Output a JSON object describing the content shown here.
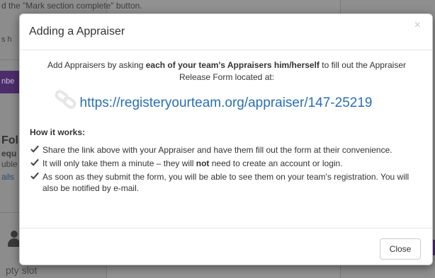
{
  "background": {
    "top_text": "d the \"Mark section complete\" button.",
    "left_fragments": [
      "s h",
      "nbe",
      "Fol",
      "equ",
      "uble",
      "ails"
    ],
    "bottom_text": "pty slot"
  },
  "modal": {
    "title": "Adding a Appraiser",
    "close_symbol": "×",
    "intro_before": "Add Appraisers by asking ",
    "intro_bold_1": "each of your team's Appraisers him/herself",
    "intro_after": " to fill out the Appraiser Release Form located at:",
    "link_url": "https://registeryourteam.org/appraiser/147-25219",
    "how_heading": "How it works:",
    "steps": [
      {
        "text": "Share the link above with your Appraiser and have them fill out the form at their convenience."
      },
      {
        "before": "It will only take them a minute – they will ",
        "bold": "not",
        "after": " need to create an account or login."
      },
      {
        "text": "As soon as they submit the form, you will be able to see them on your team's registration. You will also be notified by e-mail."
      }
    ],
    "close_button_label": "Close"
  },
  "colors": {
    "link": "#2a6fb0",
    "overlay": "#8a8a8a",
    "purple_accent": "#4b2d6b"
  }
}
